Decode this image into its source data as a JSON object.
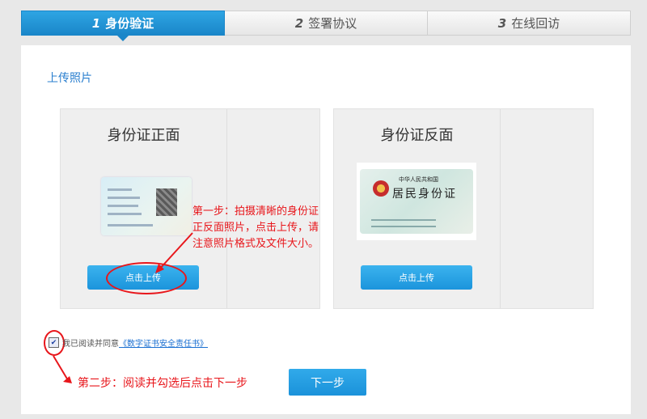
{
  "steps": [
    {
      "num": "1",
      "label": "身份验证",
      "active": true
    },
    {
      "num": "2",
      "label": "签署协议",
      "active": false
    },
    {
      "num": "3",
      "label": "在线回访",
      "active": false
    }
  ],
  "section_title": "上传照片",
  "cards": {
    "front": {
      "title": "身份证正面",
      "button": "点击上传"
    },
    "back": {
      "title": "身份证反面",
      "button": "点击上传",
      "card_text_1": "中华人民共和国",
      "card_text_2": "居民身份证"
    }
  },
  "annotations": {
    "step1_line1": "第一步：拍摄清晰的身份证",
    "step1_line2": "正反面照片，点击上传，请",
    "step1_line3": "注意照片格式及文件大小。",
    "step2": "第二步：阅读并勾选后点击下一步"
  },
  "agreement": {
    "checked": true,
    "prefix": "我已阅读并同意",
    "link": "《数字证书安全责任书》"
  },
  "next_button": "下一步",
  "colors": {
    "accent": "#1b94dc",
    "annotation": "#e8161b",
    "link": "#1a6fd1"
  }
}
